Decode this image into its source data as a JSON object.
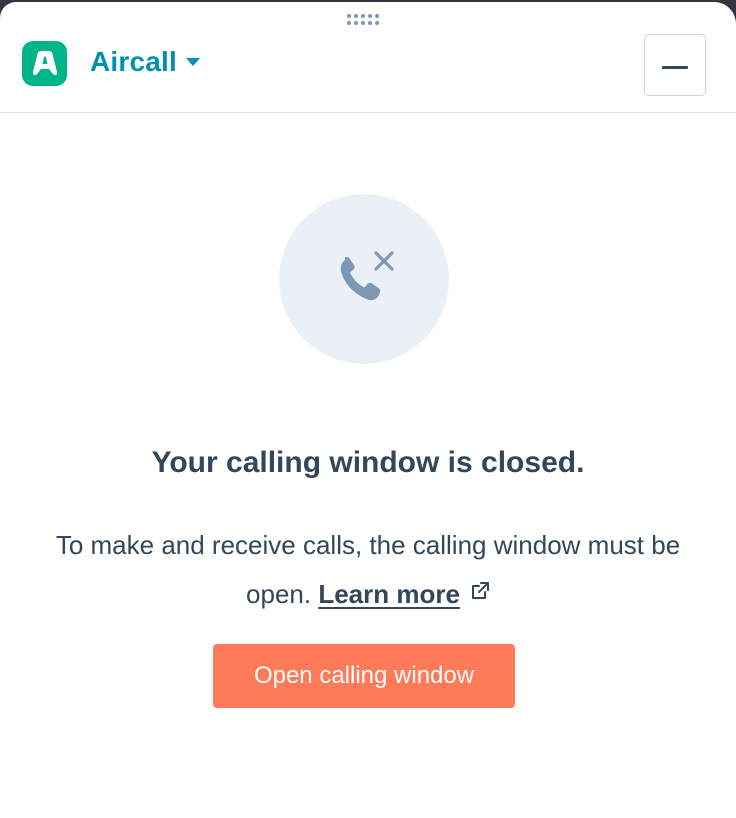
{
  "header": {
    "app_name": "Aircall",
    "logo_icon": "aircall-logo-icon",
    "switcher_icon": "caret-down-icon",
    "minimize_icon": "minimize-icon"
  },
  "main": {
    "status_icon": "phone-x-icon",
    "title": "Your calling window is closed.",
    "description": "To make and receive calls, the calling window must be open.",
    "learn_more_label": "Learn more",
    "learn_more_icon": "external-link-icon",
    "open_button_label": "Open calling window"
  },
  "colors": {
    "brand_green": "#00b388",
    "app_name_teal": "#0091ae",
    "cta_orange": "#ff7a59",
    "text_dark": "#33475b",
    "icon_slate": "#7c98b6",
    "circle_bg": "#eaf0f6"
  }
}
